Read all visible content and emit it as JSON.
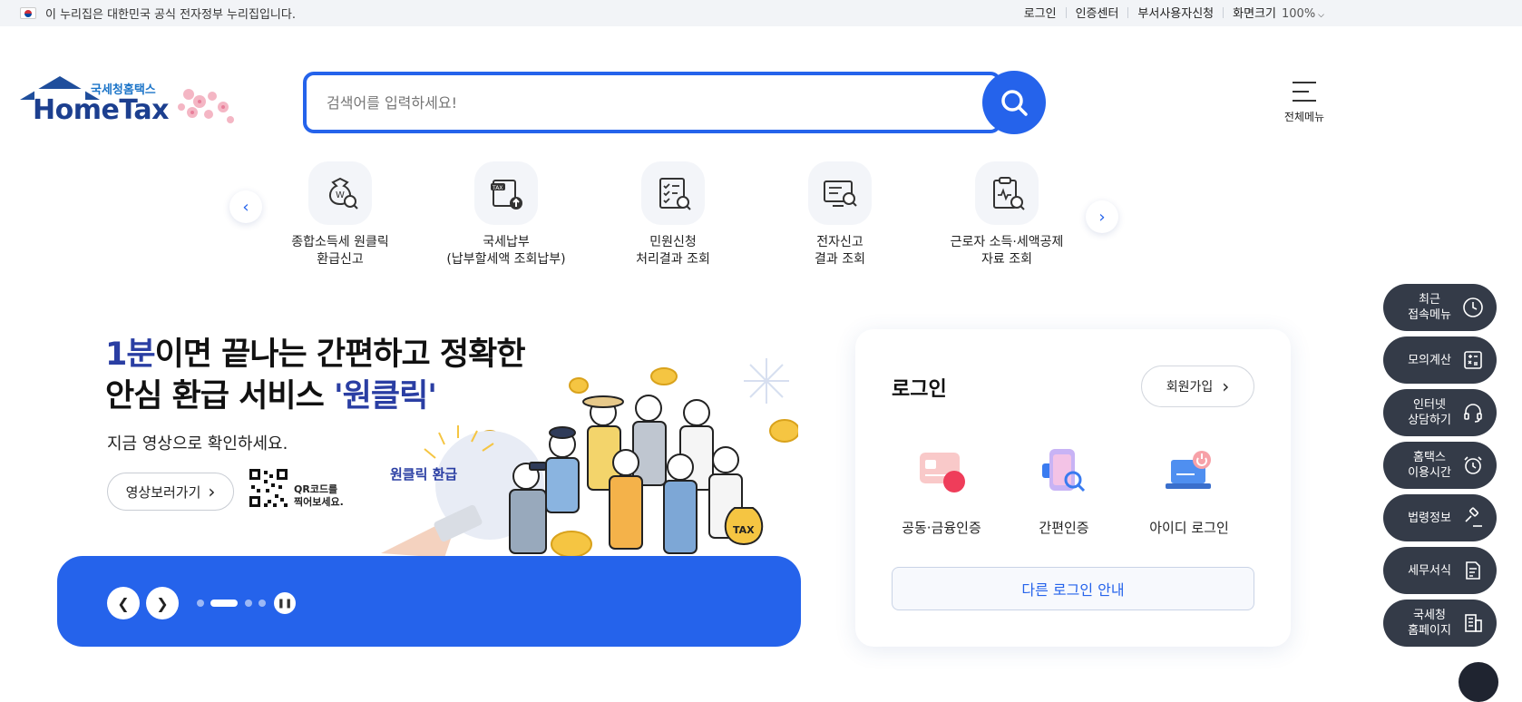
{
  "govbar": {
    "notice": "이 누리집은 대한민국 공식 전자정부 누리집입니다.",
    "links": [
      "로그인",
      "인증센터",
      "부서사용자신청"
    ],
    "zoom_label": "화면크기",
    "zoom_value": "100%"
  },
  "header": {
    "logo_sub": "국세청홈택스",
    "logo_main": "HomeTax",
    "search_placeholder": "검색어를 입력하세요!",
    "allmenu_label": "전체메뉴"
  },
  "quick_items": [
    {
      "line1": "종합소득세 원클릭",
      "line2": "환급신고",
      "icon": "money-bag-search-icon"
    },
    {
      "line1": "국세납부",
      "line2": "(납부할세액 조회납부)",
      "icon": "tax-document-upload-icon"
    },
    {
      "line1": "민원신청",
      "line2": "처리결과 조회",
      "icon": "checklist-search-icon"
    },
    {
      "line1": "전자신고",
      "line2": "결과 조회",
      "icon": "monitor-search-icon"
    },
    {
      "line1": "근로자 소득·세액공제",
      "line2": "자료 조회",
      "icon": "clipboard-search-icon"
    }
  ],
  "banner": {
    "title_accent": "1분",
    "title_rest": "이면 끝나는 간편하고 정확한",
    "title_line2_a": "안심 환급 서비스 ",
    "title_line2_accent": "'원클릭'",
    "subtitle": "지금 영상으로 확인하세요.",
    "video_button": "영상보러가기",
    "qr_line1": "QR코드를",
    "qr_line2": "찍어보세요.",
    "badge_text": "원클릭 환급",
    "bag_text": "TAX",
    "slide_count": 4,
    "active_slide": 2
  },
  "login": {
    "title": "로그인",
    "join_button": "회원가입",
    "options": [
      {
        "label": "공동·금융인증",
        "icon": "certificate-icon"
      },
      {
        "label": "간편인증",
        "icon": "simple-auth-icon"
      },
      {
        "label": "아이디 로그인",
        "icon": "id-login-icon"
      }
    ],
    "other_login": "다른 로그인 안내"
  },
  "side_menu": [
    {
      "line1": "최근",
      "line2": "접속메뉴",
      "icon": "clock-icon"
    },
    {
      "line1": "모의계산",
      "line2": "",
      "icon": "calculator-icon"
    },
    {
      "line1": "인터넷",
      "line2": "상담하기",
      "icon": "headset-icon"
    },
    {
      "line1": "홈택스",
      "line2": "이용시간",
      "icon": "alarm-icon"
    },
    {
      "line1": "법령정보",
      "line2": "",
      "icon": "gavel-icon"
    },
    {
      "line1": "세무서식",
      "line2": "",
      "icon": "form-icon"
    },
    {
      "line1": "국세청",
      "line2": "홈페이지",
      "icon": "building-icon"
    }
  ],
  "colors": {
    "primary": "#2563eb",
    "logo_blue": "#1c3f8f",
    "side_bg": "#343b48",
    "accent_text": "#2a3ea3"
  }
}
